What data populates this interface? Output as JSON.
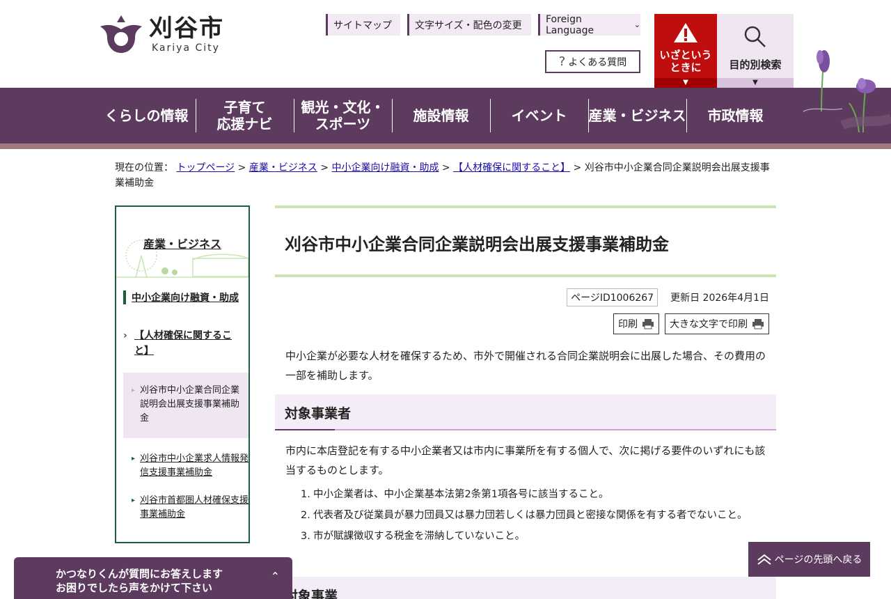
{
  "header": {
    "logo_ja": "刈谷市",
    "logo_en": "Kariya City",
    "sitemap": "サイトマップ",
    "fontsize": "文字サイズ・配色の変更",
    "language": "Foreign Language",
    "faq": "よくある質問",
    "emergency_line1": "いざという",
    "emergency_line2": "ときに",
    "purpose_search": "目的別検索"
  },
  "nav": {
    "items": [
      {
        "line1": "くらしの情報",
        "line2": ""
      },
      {
        "line1": "子育て",
        "line2": "応援ナビ"
      },
      {
        "line1": "観光・文化・",
        "line2": "スポーツ"
      },
      {
        "line1": "施設情報",
        "line2": ""
      },
      {
        "line1": "イベント",
        "line2": ""
      },
      {
        "line1": "産業・ビジネス",
        "line2": ""
      },
      {
        "line1": "市政情報",
        "line2": ""
      }
    ]
  },
  "breadcrumb": {
    "prefix": "現在の位置：",
    "links": [
      "トップページ",
      "産業・ビジネス",
      "中小企業向け融資・助成",
      "【人材確保に関すること】"
    ],
    "sep": " > ",
    "current": "刈谷市中小企業合同企業説明会出展支援事業補助金"
  },
  "sidebar": {
    "title": "産業・ビジネス",
    "level1": "中小企業向け融資・助成",
    "level2": "【人材確保に関すること】",
    "current": "刈谷市中小企業合同企業説明会出展支援事業補助金",
    "sub_items": [
      "刈谷市中小企業求人情報発信支援事業補助金",
      "刈谷市首都圏人材確保支援事業補助金"
    ]
  },
  "main": {
    "title": "刈谷市中小企業合同企業説明会出展支援事業補助金",
    "page_id": "ページID1006267",
    "updated": "更新日 2026年4月1日",
    "print": "印刷",
    "print_large": "大きな文字で印刷",
    "intro": "中小企業が必要な人材を確保するため、市外で開催される合同企業説明会に出展した場合、その費用の一部を補助します。",
    "section1_heading": "対象事業者",
    "section1_text": "市内に本店登記を有する中小企業者又は市内に事業所を有する個人で、次に掲げる要件のいずれにも該当するものとします。",
    "section1_list": [
      {
        "num": "1.",
        "text": "中小企業者は、中小企業基本法第2条第1項各号に該当すること。"
      },
      {
        "num": "2.",
        "text": "代表者及び従業員が暴力団員又は暴力団若しくは暴力団員と密接な関係を有する者でないこと。"
      },
      {
        "num": "3.",
        "text": "市が賦課徴収する税金を滞納していないこと。"
      }
    ],
    "section2_heading": "対象事業"
  },
  "chat": {
    "line1": "かつなりくんが質問にお答えします",
    "line2": "お困りでしたら声をかけて下さい"
  },
  "back_to_top": "ページの先頭へ戻る",
  "colors": {
    "brand_purple": "#5c3b5e",
    "emergency_red": "#c00d0d",
    "sidebar_green": "#1b5e3e",
    "title_green": "#c9e6b2"
  }
}
